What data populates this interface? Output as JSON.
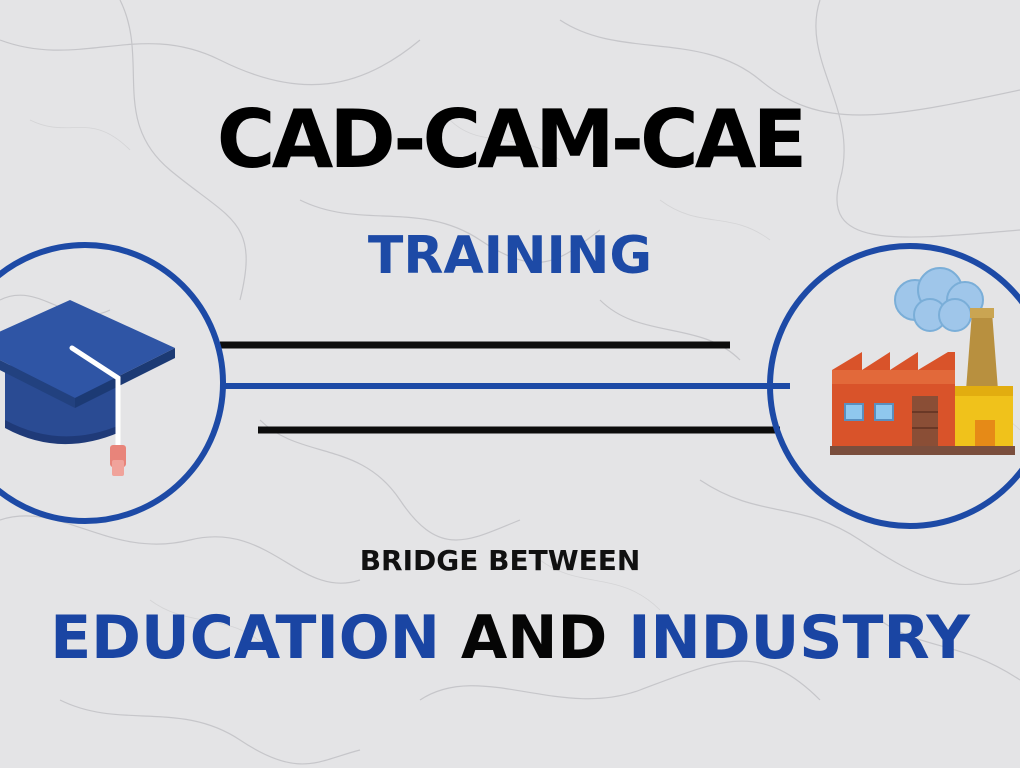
{
  "title": "CAD-CAM-CAE",
  "subtitle": "TRAINING",
  "bridge_label": "BRIDGE BETWEEN",
  "tagline": {
    "part1": "EDUCATION",
    "part2": "AND",
    "part3": "INDUSTRY"
  },
  "icons": {
    "left": "graduation-cap-icon",
    "right": "factory-icon"
  },
  "colors": {
    "accent_blue": "#1d4aa6",
    "text_black": "#000000",
    "background": "#e3e3e5"
  }
}
